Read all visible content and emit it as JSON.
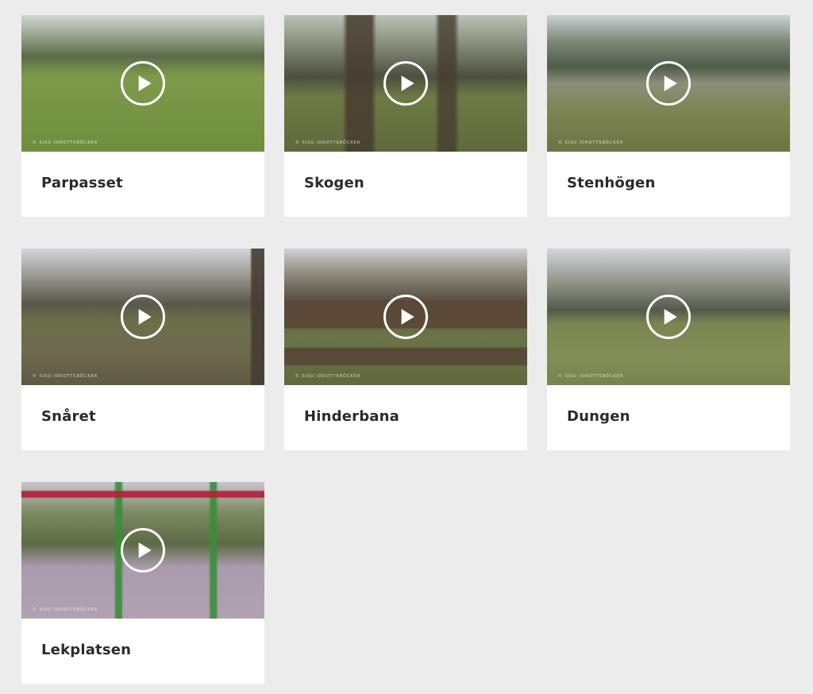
{
  "cards": [
    {
      "title": "Parpasset",
      "watermark": "© SISU IDROTTSBÖCKER",
      "play_icon": "play-circle-icon",
      "colors": {
        "sky": "#cfd6d0",
        "trees": "#5b6b4a",
        "ground": "#6f8f3e"
      }
    },
    {
      "title": "Skogen",
      "watermark": "© SISU IDROTTSBÖCKER",
      "play_icon": "play-circle-icon",
      "colors": {
        "sky": "#b9c3b7",
        "trees": "#4d4f40",
        "ground": "#6e7a45"
      }
    },
    {
      "title": "Stenhögen",
      "watermark": "© SISU IDROTTSBÖCKER",
      "play_icon": "play-circle-icon",
      "colors": {
        "sky": "#c8d2cf",
        "trees": "#4f5d47",
        "ground": "#7c8452"
      }
    },
    {
      "title": "Snåret",
      "watermark": "© SISU IDROTTSBÖCKER",
      "play_icon": "play-circle-icon",
      "colors": {
        "sky": "#d4d6dc",
        "trees": "#5b574c",
        "ground": "#6d6a4e"
      }
    },
    {
      "title": "Hinderbana",
      "watermark": "© SISU IDROTTSBÖCKER",
      "play_icon": "play-circle-icon",
      "colors": {
        "sky": "#cfd2d6",
        "trees": "#5c5548",
        "ground": "#6b7447"
      }
    },
    {
      "title": "Dungen",
      "watermark": "© SISU IDROTTSBÖCKER",
      "play_icon": "play-circle-icon",
      "colors": {
        "sky": "#d3d5dd",
        "trees": "#55594a",
        "ground": "#7a8652"
      }
    },
    {
      "title": "Lekplatsen",
      "watermark": "© SISU IDROTTSBÖCKER",
      "play_icon": "play-circle-icon",
      "colors": {
        "sky": "#c9c6cf",
        "trees": "#5c6b45",
        "ground": "#a99bab"
      }
    }
  ],
  "colors": {
    "page_bg": "#ececec",
    "card_bg": "#ffffff",
    "title_text": "#2b2b2b",
    "play_ring": "#ffffff"
  }
}
